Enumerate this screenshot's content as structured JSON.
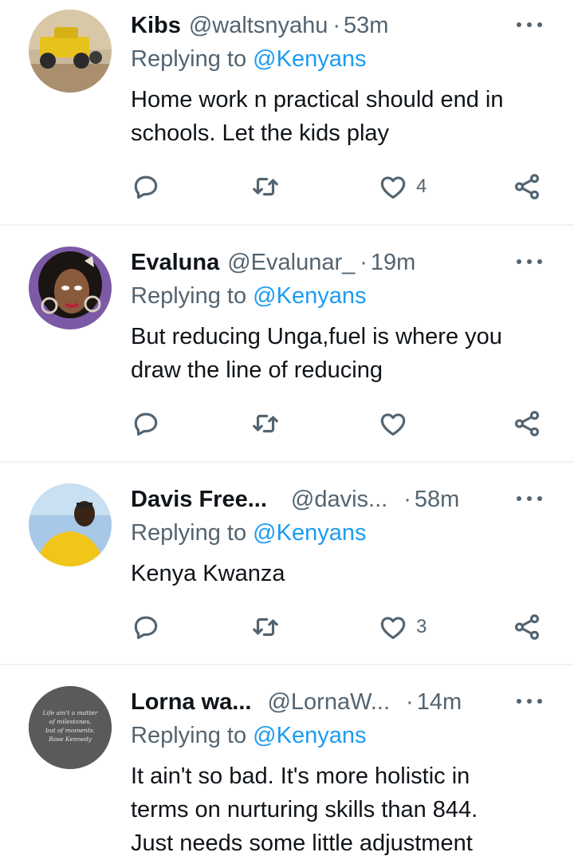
{
  "tweets": [
    {
      "name": "Kibs",
      "handle": "@waltsnyahu",
      "time": "53m",
      "replying_prefix": "Replying to",
      "replying_to": "@Kenyans",
      "text_lines": [
        "Home work n practical should end in",
        "schools. Let the kids play"
      ],
      "likes": "4"
    },
    {
      "name": "Evaluna",
      "handle": "@Evalunar_",
      "time": "19m",
      "replying_prefix": "Replying to",
      "replying_to": "@Kenyans",
      "text_lines": [
        "But reducing Unga,fuel is where you",
        "draw the line of reducing"
      ],
      "likes": ""
    },
    {
      "name": "Davis Free...",
      "handle": "@davis...",
      "time": "58m",
      "replying_prefix": "Replying to",
      "replying_to": "@Kenyans",
      "text_lines": [
        "Kenya Kwanza"
      ],
      "likes": "3"
    },
    {
      "name": "Lorna wa...",
      "handle": "@LornaW...",
      "time": "14m",
      "replying_prefix": "Replying to",
      "replying_to": "@Kenyans",
      "text_lines": [
        "It ain't so bad. It's more holistic in",
        "terms on nurturing skills than 844.",
        "Just needs some little adjustment"
      ],
      "likes": ""
    }
  ],
  "avatar4_text": [
    "Life ain't a matter",
    "of milestones,",
    "but of moments.",
    "Rose Kennedy"
  ],
  "colors": {
    "text": "#0f1419",
    "secondary": "#536471",
    "accent": "#1d9bf0",
    "divider": "#eff3f4"
  },
  "icons": [
    "reply-icon",
    "retweet-icon",
    "like-icon",
    "share-icon",
    "more-icon"
  ]
}
